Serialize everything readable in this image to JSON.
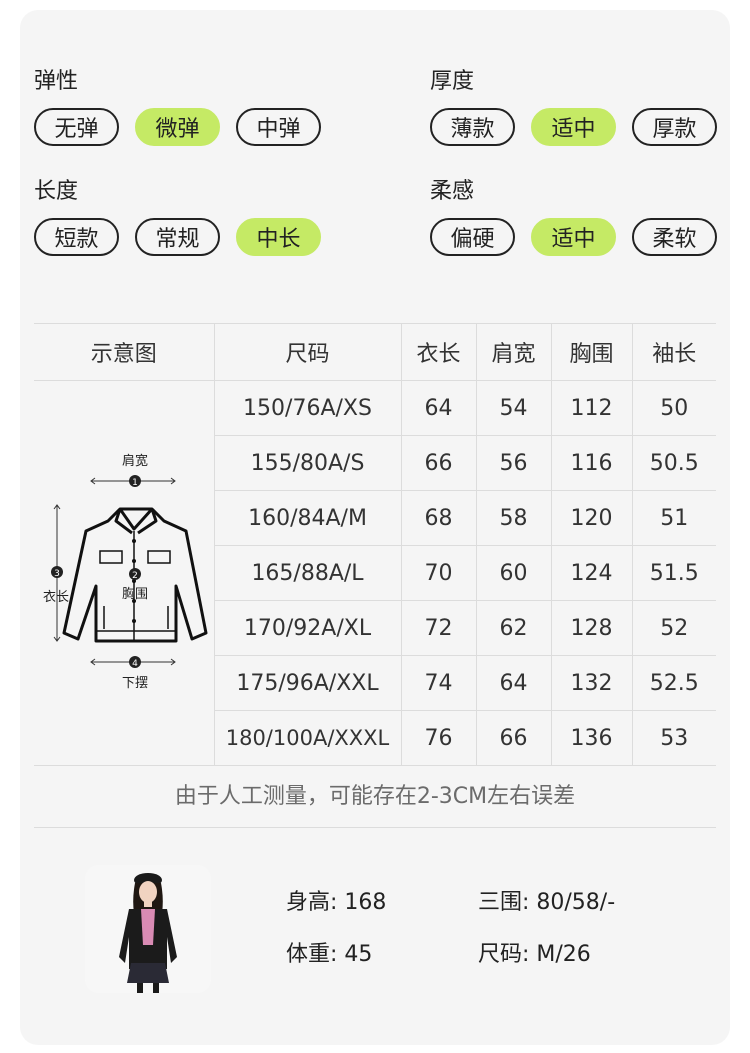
{
  "attributes": [
    {
      "title": "弹性",
      "options": [
        "无弹",
        "微弹",
        "中弹"
      ],
      "selected": 1
    },
    {
      "title": "厚度",
      "options": [
        "薄款",
        "适中",
        "厚款"
      ],
      "selected": 1
    },
    {
      "title": "长度",
      "options": [
        "短款",
        "常规",
        "中长"
      ],
      "selected": 2
    },
    {
      "title": "柔感",
      "options": [
        "偏硬",
        "适中",
        "柔软"
      ],
      "selected": 1
    }
  ],
  "table": {
    "headers": [
      "示意图",
      "尺码",
      "衣长",
      "肩宽",
      "胸围",
      "袖长"
    ],
    "rows": [
      [
        "150/76A/XS",
        "64",
        "54",
        "112",
        "50"
      ],
      [
        "155/80A/S",
        "66",
        "56",
        "116",
        "50.5"
      ],
      [
        "160/84A/M",
        "68",
        "58",
        "120",
        "51"
      ],
      [
        "165/88A/L",
        "70",
        "60",
        "124",
        "51.5"
      ],
      [
        "170/92A/XL",
        "72",
        "62",
        "128",
        "52"
      ],
      [
        "175/96A/XXL",
        "74",
        "64",
        "132",
        "52.5"
      ],
      [
        "180/100A/XXXL",
        "76",
        "66",
        "136",
        "53"
      ]
    ]
  },
  "diagram": {
    "shoulder_label": "肩宽",
    "chest_label": "胸围",
    "length_label": "衣长",
    "hem_label": "下摆",
    "marker_1": "1",
    "marker_2": "2",
    "marker_3": "3",
    "marker_4": "4"
  },
  "note": "由于人工测量，可能存在2-3CM左右误差",
  "model": {
    "height": "身高: 168",
    "measurements": "三围:   80/58/-",
    "weight": "体重:   45",
    "size": "尺码:  M/26"
  },
  "colors": {
    "active_pill": "#c5ea65",
    "card_bg": "#f5f5f5",
    "jacket": "#1b1b1b",
    "shirt": "#d98bb4",
    "skirt": "#2a2a35"
  }
}
